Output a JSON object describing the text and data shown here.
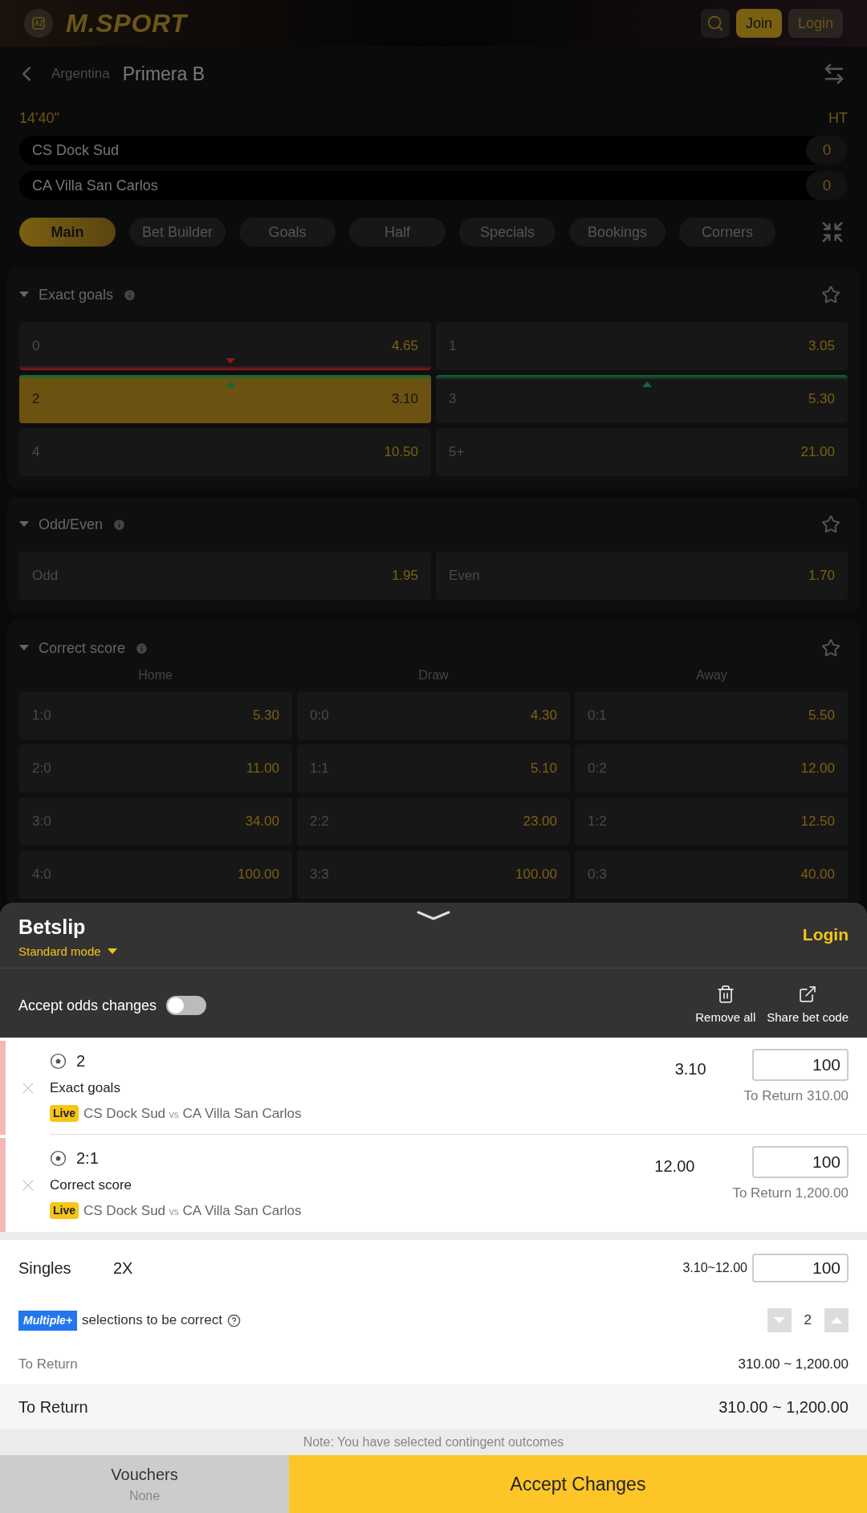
{
  "header": {
    "logo": "M.SPORT",
    "join": "Join",
    "login": "Login"
  },
  "match": {
    "country": "Argentina",
    "league": "Primera B",
    "time": "14'40\"",
    "period": "HT",
    "teams": [
      {
        "name": "CS Dock Sud",
        "score": "0"
      },
      {
        "name": "CA Villa San Carlos",
        "score": "0"
      }
    ]
  },
  "tabs": [
    {
      "label": "Main",
      "selected": true
    },
    {
      "label": "Bet Builder",
      "selected": false
    },
    {
      "label": "Goals",
      "selected": false
    },
    {
      "label": "Half",
      "selected": false
    },
    {
      "label": "Specials",
      "selected": false
    },
    {
      "label": "Bookings",
      "selected": false
    },
    {
      "label": "Corners",
      "selected": false
    }
  ],
  "markets": [
    {
      "title": "Exact goals",
      "expanded": true,
      "cells": [
        {
          "label": "0",
          "odds": "4.65",
          "selected": false,
          "odds_down": true,
          "odds_up": false
        },
        {
          "label": "1",
          "odds": "3.05",
          "selected": false,
          "odds_down": false,
          "odds_up": false
        },
        {
          "label": "2",
          "odds": "3.10",
          "selected": true,
          "odds_down": false,
          "odds_up": true
        },
        {
          "label": "3",
          "odds": "5.30",
          "selected": false,
          "odds_down": false,
          "odds_up": true
        },
        {
          "label": "4",
          "odds": "10.50",
          "selected": false,
          "odds_down": false,
          "odds_up": false
        },
        {
          "label": "5+",
          "odds": "21.00",
          "selected": false,
          "odds_down": false,
          "odds_up": false
        }
      ]
    },
    {
      "title": "Odd/Even",
      "expanded": true,
      "cells": [
        {
          "label": "Odd",
          "odds": "1.95",
          "selected": false
        },
        {
          "label": "Even",
          "odds": "1.70",
          "selected": false
        }
      ]
    },
    {
      "title": "Correct score",
      "expanded": true,
      "columns": [
        "Home",
        "Draw",
        "Away"
      ],
      "cells": [
        {
          "label": "1:0",
          "odds": "5.30",
          "selected": false
        },
        {
          "label": "0:0",
          "odds": "4.30",
          "selected": false
        },
        {
          "label": "0:1",
          "odds": "5.50",
          "selected": false
        },
        {
          "label": "2:0",
          "odds": "11.00",
          "selected": false
        },
        {
          "label": "1:1",
          "odds": "5.10",
          "selected": false
        },
        {
          "label": "0:2",
          "odds": "12.00",
          "selected": false
        },
        {
          "label": "3:0",
          "odds": "34.00",
          "selected": false
        },
        {
          "label": "2:2",
          "odds": "23.00",
          "selected": false
        },
        {
          "label": "1:2",
          "odds": "12.50",
          "selected": false
        },
        {
          "label": "4:0",
          "odds": "100.00",
          "selected": false
        },
        {
          "label": "3:3",
          "odds": "100.00",
          "selected": false
        },
        {
          "label": "0:3",
          "odds": "40.00",
          "selected": false
        }
      ]
    }
  ],
  "betslip": {
    "title": "Betslip",
    "mode": "Standard mode",
    "login": "Login",
    "accept_odds_label": "Accept odds changes",
    "accept_odds_on": false,
    "remove_all": "Remove all",
    "share": "Share bet code",
    "bets": [
      {
        "pick": "2",
        "odds": "3.10",
        "market": "Exact goals",
        "badge": "Live",
        "home": "CS Dock Sud",
        "vs": "vs",
        "away": "CA Villa San Carlos",
        "stake": "100",
        "to_return": "To Return 310.00"
      },
      {
        "pick": "2:1",
        "odds": "12.00",
        "market": "Correct score",
        "badge": "Live",
        "home": "CS Dock Sud",
        "vs": "vs",
        "away": "CA Villa San Carlos",
        "stake": "100",
        "to_return": "To Return 1,200.00"
      }
    ],
    "singles": {
      "label": "Singles",
      "count": "2X",
      "range": "3.10~12.00",
      "stake": "100"
    },
    "multiple": {
      "badge": "Multiple+",
      "text": "selections to be correct",
      "value": "2"
    },
    "to_return_label": "To Return",
    "to_return_value": "310.00 ~ 1,200.00",
    "total_label": "To Return",
    "total_value": "310.00 ~ 1,200.00",
    "note": "Note: You have selected contingent outcomes",
    "vouchers": "Vouchers",
    "vouchers_value": "None",
    "accept": "Accept Changes"
  }
}
